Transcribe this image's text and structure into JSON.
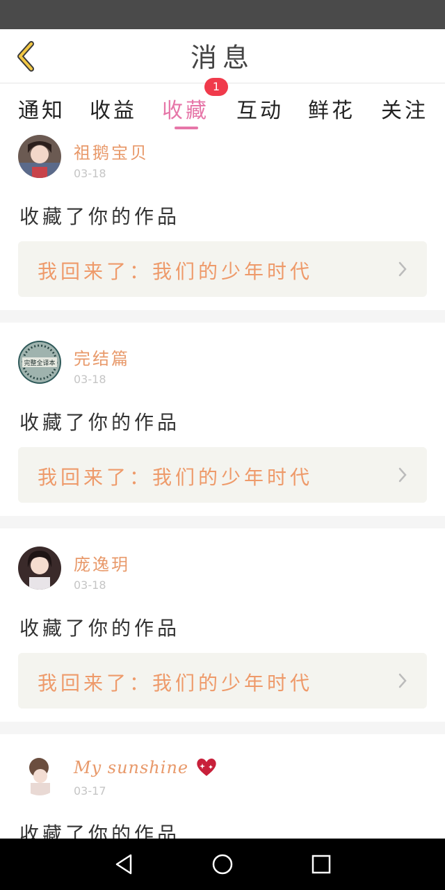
{
  "header": {
    "title": "消息"
  },
  "tabs": [
    {
      "label": "通知"
    },
    {
      "label": "收益"
    },
    {
      "label": "收藏"
    },
    {
      "label": "互动"
    },
    {
      "label": "鲜花"
    },
    {
      "label": "关注"
    }
  ],
  "active_tab_index": 2,
  "badge": {
    "count": "1"
  },
  "feed": [
    {
      "user": "祖鹅宝贝",
      "time": "03-18",
      "action": "收藏了你的作品",
      "work": "我回来了：我们的少年时代",
      "avatar_label": ""
    },
    {
      "user": "完结篇",
      "time": "03-18",
      "action": "收藏了你的作品",
      "work": "我回来了：我们的少年时代",
      "avatar_label": "完整全译本"
    },
    {
      "user": "庞逸玥",
      "time": "03-18",
      "action": "收藏了你的作品",
      "work": "我回来了：我们的少年时代",
      "avatar_label": ""
    },
    {
      "user": "My sunshine",
      "time": "03-17",
      "action": "收藏了你的作品",
      "work": "",
      "avatar_label": ""
    }
  ],
  "colors": {
    "accent": "#e676a8",
    "name": "#e8996a",
    "badge": "#f03a4b",
    "back": "#f2c744"
  }
}
